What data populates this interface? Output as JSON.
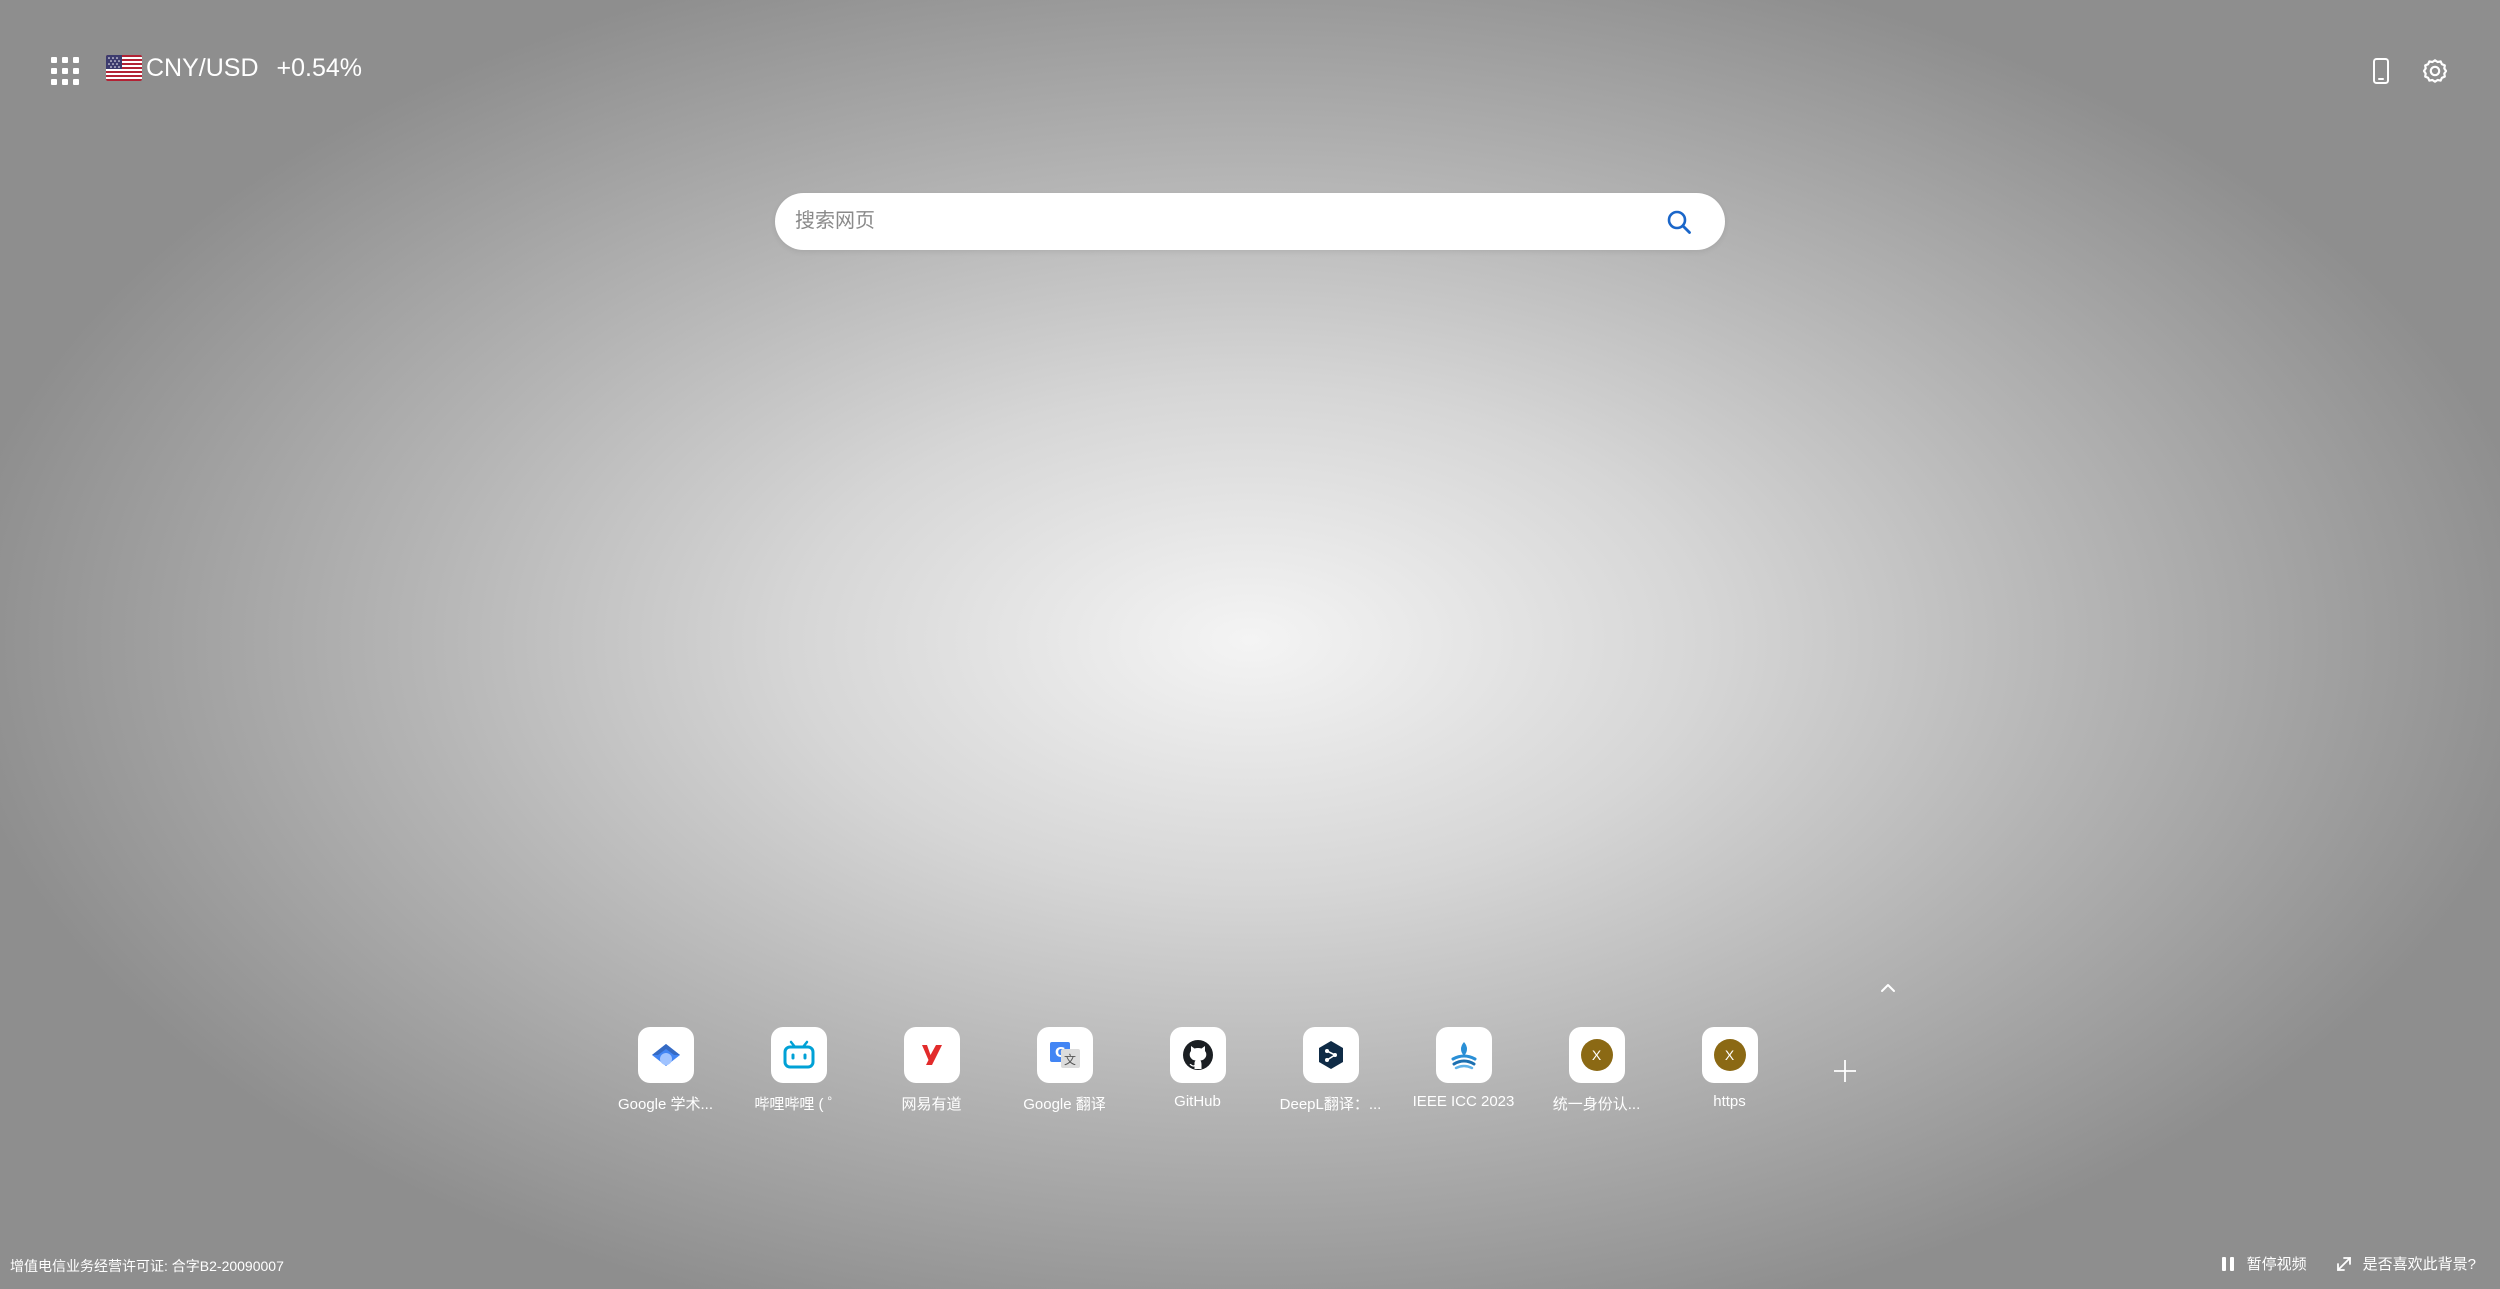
{
  "topbar": {
    "currency_pair": "CNY/USD",
    "currency_change": "+0.54%",
    "flag_icon": "us-flag-icon",
    "apps_icon": "apps-grid-icon",
    "phone_icon": "mobile-phone-icon",
    "settings_icon": "gear-icon"
  },
  "search": {
    "placeholder": "搜索网页",
    "search_icon": "search-icon",
    "accent": "#1a66c9"
  },
  "shortcuts": [
    {
      "label": "Google 学术...",
      "icon": "google-scholar-icon"
    },
    {
      "label": "哔哩哔哩 ( ゜",
      "icon": "bilibili-icon"
    },
    {
      "label": "网易有道",
      "icon": "youdao-icon"
    },
    {
      "label": "Google 翻译",
      "icon": "google-translate-icon"
    },
    {
      "label": "GitHub",
      "icon": "github-icon"
    },
    {
      "label": "DeepL翻译：...",
      "icon": "deepl-icon"
    },
    {
      "label": "IEEE ICC 2023",
      "icon": "ieee-icc-icon"
    },
    {
      "label": "统一身份认...",
      "icon": "x-badge-icon",
      "badge_text": "X"
    },
    {
      "label": "https",
      "icon": "x-badge-icon",
      "badge_text": "X"
    }
  ],
  "footer": {
    "license": "增值电信业务经营许可证: 合字B2-20090007",
    "pause_label": "暂停视频",
    "feedback_label": "是否喜欢此背景?"
  }
}
